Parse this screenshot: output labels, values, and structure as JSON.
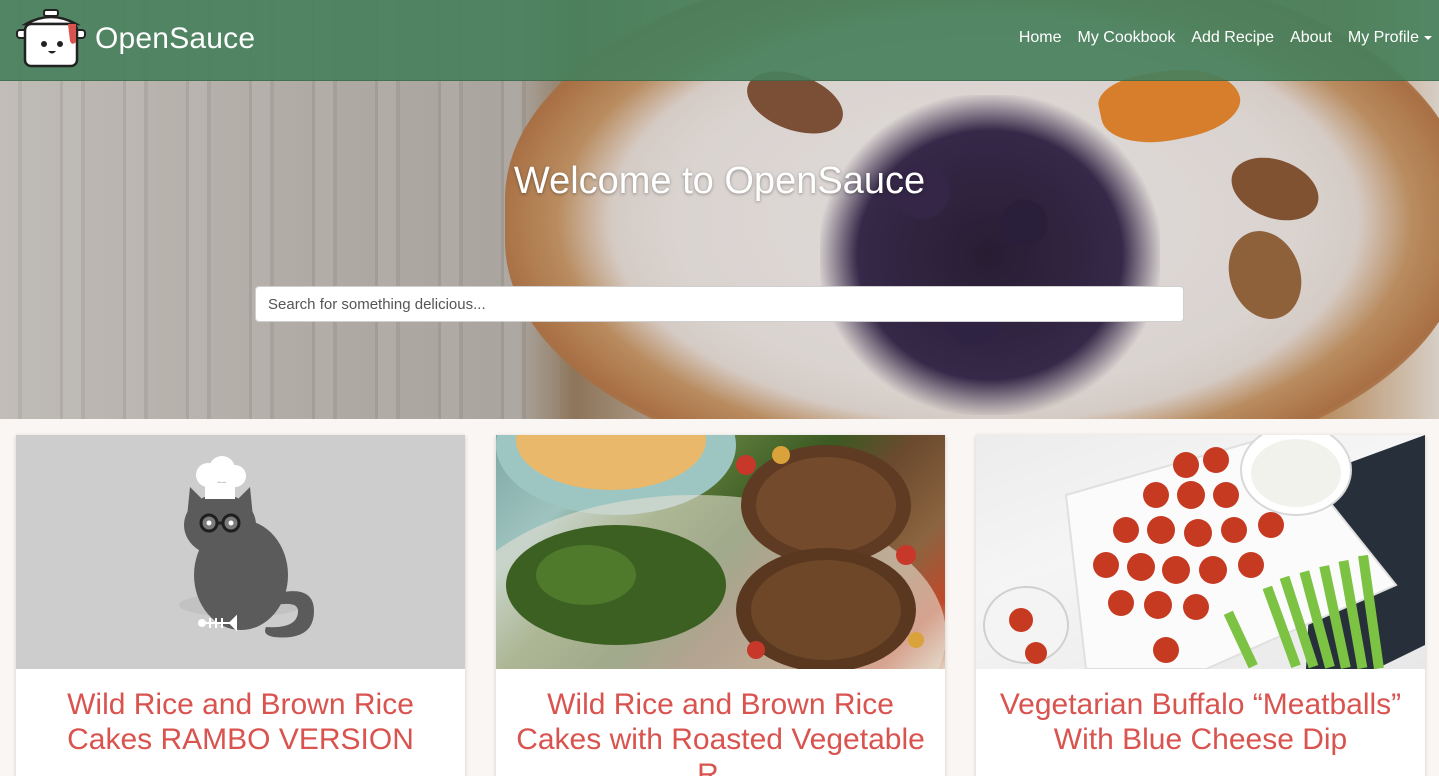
{
  "navbar": {
    "brand_name": "OpenSauce",
    "items": [
      {
        "label": "Home"
      },
      {
        "label": "My Cookbook"
      },
      {
        "label": "Add Recipe"
      },
      {
        "label": "About"
      },
      {
        "label": "My Profile"
      }
    ]
  },
  "hero": {
    "title": "Welcome to OpenSauce",
    "search_placeholder": "Search for something delicious..."
  },
  "recipes": [
    {
      "title": "Wild Rice and Brown Rice Cakes RAMBO VERSION",
      "image": "chef-cat-placeholder"
    },
    {
      "title": "Wild Rice and Brown Rice Cakes with Roasted Vegetable R...",
      "image": "rice-cakes-with-vegetables"
    },
    {
      "title": "Vegetarian Buffalo “Meatballs” With Blue Cheese Dip",
      "image": "buffalo-meatballs-with-celery"
    }
  ],
  "colors": {
    "navbar_bg": "#48805c",
    "recipe_title": "#d9534f",
    "page_bg": "#faf6f4"
  }
}
